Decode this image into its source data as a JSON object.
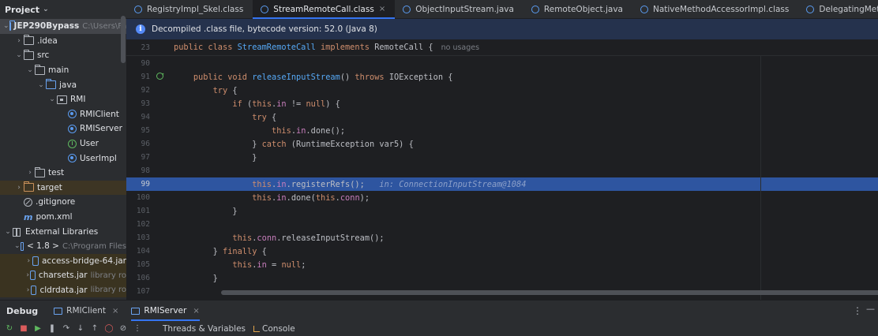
{
  "project_panel": {
    "title": "Project",
    "tree": [
      {
        "indent": 0,
        "arrow": "v",
        "icon": "module-folder-icon",
        "label": "JEP290Bypass",
        "extra": "C:\\Users\\Fa",
        "bold": true,
        "selected": true
      },
      {
        "indent": 1,
        "arrow": ">",
        "icon": "folder-icon",
        "label": ".idea"
      },
      {
        "indent": 1,
        "arrow": "v",
        "icon": "folder-icon",
        "label": "src"
      },
      {
        "indent": 2,
        "arrow": "v",
        "icon": "folder-icon",
        "label": "main"
      },
      {
        "indent": 3,
        "arrow": "v",
        "icon": "source-folder-icon",
        "label": "java"
      },
      {
        "indent": 4,
        "arrow": "v",
        "icon": "package-icon",
        "label": "RMI"
      },
      {
        "indent": 5,
        "arrow": "",
        "icon": "class-icon",
        "label": "RMIClient"
      },
      {
        "indent": 5,
        "arrow": "",
        "icon": "class-icon",
        "label": "RMIServer"
      },
      {
        "indent": 5,
        "arrow": "",
        "icon": "interface-icon",
        "label": "User"
      },
      {
        "indent": 5,
        "arrow": "",
        "icon": "class-icon",
        "label": "UserImpl"
      },
      {
        "indent": 2,
        "arrow": ">",
        "icon": "folder-icon",
        "label": "test"
      },
      {
        "indent": 1,
        "arrow": ">",
        "icon": "excluded-folder-icon",
        "label": "target",
        "highlight": "target"
      },
      {
        "indent": 1,
        "arrow": "",
        "icon": "gitignore-icon",
        "label": ".gitignore"
      },
      {
        "indent": 1,
        "arrow": "",
        "icon": "maven-icon",
        "label": "pom.xml"
      },
      {
        "indent": 0,
        "arrow": "v",
        "icon": "libraries-icon",
        "label": "External Libraries"
      },
      {
        "indent": 1,
        "arrow": "v",
        "icon": "jdk-icon",
        "label": "< 1.8 >",
        "extra": "C:\\Program Files"
      },
      {
        "indent": 2,
        "arrow": ">",
        "icon": "jar-icon",
        "label": "access-bridge-64.jar",
        "highlight": "hl"
      },
      {
        "indent": 2,
        "arrow": ">",
        "icon": "jar-icon",
        "label": "charsets.jar",
        "extra": "library ro",
        "highlight": "hl"
      },
      {
        "indent": 2,
        "arrow": ">",
        "icon": "jar-icon",
        "label": "cldrdata.jar",
        "extra": "library ro",
        "highlight": "hl"
      }
    ]
  },
  "tabs": [
    {
      "label": "RegistryImpl_Skel.class",
      "active": false
    },
    {
      "label": "StreamRemoteCall.class",
      "active": true
    },
    {
      "label": "ObjectInputStream.java",
      "active": false
    },
    {
      "label": "RemoteObject.java",
      "active": false
    },
    {
      "label": "NativeMethodAccessorImpl.class",
      "active": false
    },
    {
      "label": "DelegatingMethoc",
      "active": false
    }
  ],
  "banner": {
    "text": "Decompiled .class file, bytecode version: 52.0 (Java 8)"
  },
  "editor": {
    "sticky": {
      "line": "23",
      "text_kw": "public class ",
      "text_name": "StreamRemoteCall ",
      "text_kw2": "implements ",
      "text_rest": "RemoteCall {",
      "hint": "no usages"
    },
    "lines": [
      {
        "n": "90",
        "segs": []
      },
      {
        "n": "91",
        "gutter": "override-icon",
        "segs": [
          {
            "t": "    "
          },
          {
            "t": "public void ",
            "c": "kw"
          },
          {
            "t": "releaseInputStream",
            "c": "fn"
          },
          {
            "t": "() "
          },
          {
            "t": "throws ",
            "c": "kw"
          },
          {
            "t": "IOException {"
          }
        ]
      },
      {
        "n": "92",
        "segs": [
          {
            "t": "        "
          },
          {
            "t": "try ",
            "c": "kw"
          },
          {
            "t": "{"
          }
        ]
      },
      {
        "n": "93",
        "segs": [
          {
            "t": "            "
          },
          {
            "t": "if ",
            "c": "kw"
          },
          {
            "t": "("
          },
          {
            "t": "this",
            "c": "kw"
          },
          {
            "t": "."
          },
          {
            "t": "in",
            "c": "fld"
          },
          {
            "t": " != "
          },
          {
            "t": "null",
            "c": "kw"
          },
          {
            "t": ") {"
          }
        ]
      },
      {
        "n": "94",
        "segs": [
          {
            "t": "                "
          },
          {
            "t": "try ",
            "c": "kw"
          },
          {
            "t": "{"
          }
        ]
      },
      {
        "n": "95",
        "segs": [
          {
            "t": "                    "
          },
          {
            "t": "this",
            "c": "kw"
          },
          {
            "t": "."
          },
          {
            "t": "in",
            "c": "fld"
          },
          {
            "t": ".done();"
          }
        ]
      },
      {
        "n": "96",
        "segs": [
          {
            "t": "                } "
          },
          {
            "t": "catch ",
            "c": "kw"
          },
          {
            "t": "(RuntimeException var5) {"
          }
        ]
      },
      {
        "n": "97",
        "segs": [
          {
            "t": "                }"
          }
        ]
      },
      {
        "n": "98",
        "segs": []
      },
      {
        "n": "99",
        "current": true,
        "segs": [
          {
            "t": "                "
          },
          {
            "t": "this",
            "c": "kw"
          },
          {
            "t": "."
          },
          {
            "t": "in",
            "c": "fld"
          },
          {
            "t": ".registerRefs();   "
          },
          {
            "t": "in: ConnectionInputStream@1084",
            "c": "inlay"
          }
        ]
      },
      {
        "n": "100",
        "segs": [
          {
            "t": "                "
          },
          {
            "t": "this",
            "c": "kw"
          },
          {
            "t": "."
          },
          {
            "t": "in",
            "c": "fld"
          },
          {
            "t": ".done("
          },
          {
            "t": "this",
            "c": "kw"
          },
          {
            "t": "."
          },
          {
            "t": "conn",
            "c": "fld"
          },
          {
            "t": ");"
          }
        ]
      },
      {
        "n": "101",
        "segs": [
          {
            "t": "            }"
          }
        ]
      },
      {
        "n": "102",
        "segs": []
      },
      {
        "n": "103",
        "segs": [
          {
            "t": "            "
          },
          {
            "t": "this",
            "c": "kw"
          },
          {
            "t": "."
          },
          {
            "t": "conn",
            "c": "fld"
          },
          {
            "t": ".releaseInputStream();"
          }
        ]
      },
      {
        "n": "104",
        "segs": [
          {
            "t": "        } "
          },
          {
            "t": "finally ",
            "c": "kw"
          },
          {
            "t": "{"
          }
        ]
      },
      {
        "n": "105",
        "segs": [
          {
            "t": "            "
          },
          {
            "t": "this",
            "c": "kw"
          },
          {
            "t": "."
          },
          {
            "t": "in",
            "c": "fld"
          },
          {
            "t": " = "
          },
          {
            "t": "null",
            "c": "kw"
          },
          {
            "t": ";"
          }
        ]
      },
      {
        "n": "106",
        "segs": [
          {
            "t": "        }"
          }
        ]
      },
      {
        "n": "107",
        "segs": []
      }
    ]
  },
  "debug": {
    "title": "Debug",
    "tabs": [
      {
        "label": "RMIClient",
        "active": false
      },
      {
        "label": "RMIServer",
        "active": true
      }
    ],
    "sub_tabs": {
      "threads": "Threads & Variables",
      "console": "Console"
    }
  }
}
